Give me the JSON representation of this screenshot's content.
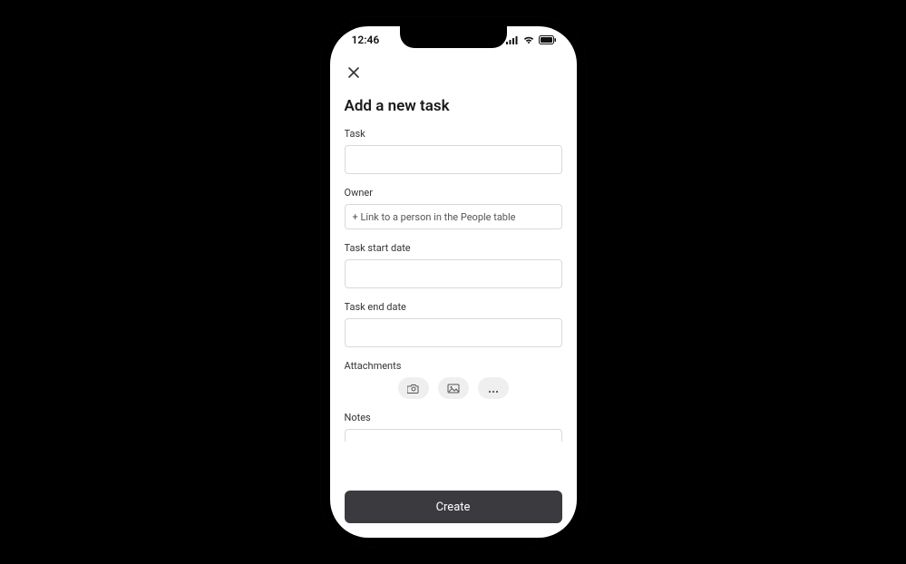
{
  "status": {
    "time": "12:46"
  },
  "header": {
    "title": "Add a new task"
  },
  "fields": {
    "task": {
      "label": "Task",
      "value": ""
    },
    "owner": {
      "label": "Owner",
      "placeholder": "+ Link to a person in the People table"
    },
    "start": {
      "label": "Task start date",
      "value": ""
    },
    "end": {
      "label": "Task end date",
      "value": ""
    },
    "attachments": {
      "label": "Attachments"
    },
    "notes": {
      "label": "Notes",
      "value": ""
    }
  },
  "buttons": {
    "create": "Create"
  }
}
